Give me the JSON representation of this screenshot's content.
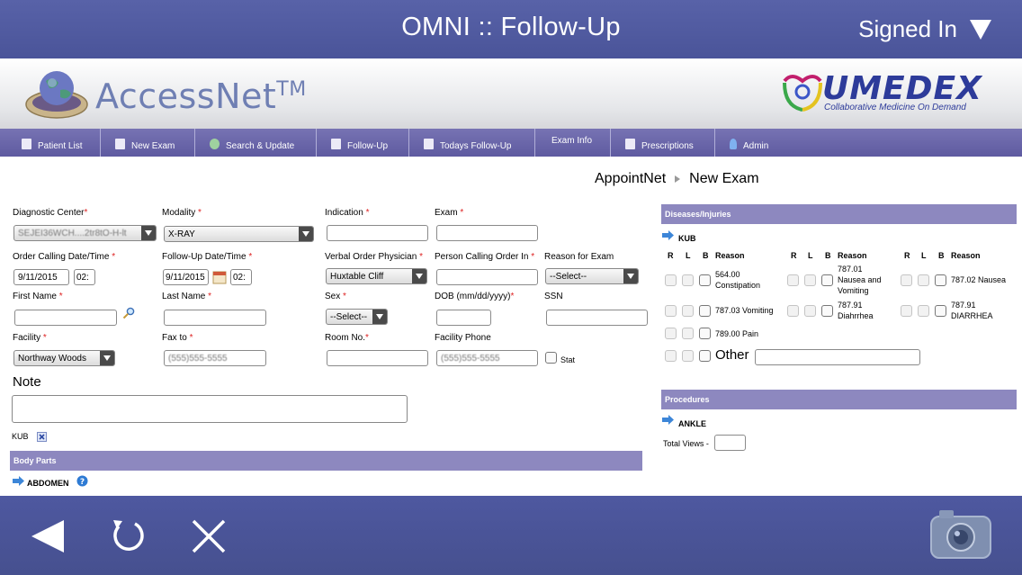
{
  "topbar": {
    "title": "OMNI :: Follow-Up",
    "signed_in": "Signed In"
  },
  "brand": {
    "accessnet": "AccessNet",
    "tm": "TM",
    "umedex": "UMEDEX",
    "umedex_tag": "Collaborative Medicine On Demand"
  },
  "nav": [
    {
      "label": "Patient List",
      "icon": "patient-list-icon"
    },
    {
      "label": "New Exam",
      "icon": "document-icon"
    },
    {
      "label": "Search & Update",
      "icon": "gear-icon"
    },
    {
      "label": "Follow-Up",
      "icon": "calendar-icon"
    },
    {
      "label": "Todays Follow-Up",
      "icon": "calendar-icon"
    },
    {
      "label": "Exam Info",
      "icon": ""
    },
    {
      "label": "Prescriptions",
      "icon": "clipboard-icon"
    },
    {
      "label": "Admin",
      "icon": "user-icon"
    }
  ],
  "breadcrumb": {
    "parent": "AppointNet",
    "current": "New Exam"
  },
  "form": {
    "diagnostic_center": {
      "label": "Diagnostic Center",
      "value": "SEJEI36WCH....2tr8tO-H-lt"
    },
    "modality": {
      "label": "Modality",
      "value": "X-RAY"
    },
    "indication": {
      "label": "Indication"
    },
    "exam": {
      "label": "Exam"
    },
    "order_calling": {
      "label": "Order Calling Date/Time",
      "date": "9/11/2015",
      "time": "02:"
    },
    "followup_dt": {
      "label": "Follow-Up Date/Time",
      "date": "9/11/2015",
      "time": "02:"
    },
    "verbal_physician": {
      "label": "Verbal Order Physician",
      "value": "Huxtable Cliff"
    },
    "person_calling": {
      "label": "Person Calling Order In"
    },
    "reason_exam": {
      "label": "Reason for Exam",
      "value": "--Select--"
    },
    "first_name": {
      "label": "First Name"
    },
    "last_name": {
      "label": "Last Name"
    },
    "sex": {
      "label": "Sex",
      "value": "--Select--"
    },
    "dob": {
      "label": "DOB (mm/dd/yyyy)"
    },
    "ssn": {
      "label": "SSN"
    },
    "facility": {
      "label": "Facility",
      "value": "Northway Woods"
    },
    "fax_to": {
      "label": "Fax to",
      "value": "(555)555-5555"
    },
    "room_no": {
      "label": "Room No."
    },
    "facility_phone": {
      "label": "Facility Phone",
      "value": "(555)555-5555"
    },
    "stat": {
      "label": "Stat"
    },
    "required_mark": "*"
  },
  "note": {
    "label": "Note"
  },
  "kub_tag": "KUB",
  "body_parts": {
    "header": "Body Parts",
    "item": "ABDOMEN"
  },
  "diseases": {
    "header": "Diseases/Injuries",
    "group": "KUB",
    "columns": {
      "r": "R",
      "l": "L",
      "b": "B",
      "reason": "Reason"
    },
    "items": [
      [
        "564.00",
        "Constipation"
      ],
      [
        "787.01",
        "Nausea and",
        "Vomiting"
      ],
      [
        "787.02 Nausea"
      ],
      [
        "787.03 Vomiting"
      ],
      [
        "787.91",
        "Diahrrhea"
      ],
      [
        "787.91",
        "DIARRHEA"
      ],
      [
        "789.00 Pain"
      ]
    ],
    "other": "Other"
  },
  "procedures": {
    "header": "Procedures",
    "item": "ANKLE",
    "total_views": "Total Views -"
  },
  "colors": {
    "bar": "#4a5499",
    "nav": "#6a66a8",
    "section": "#8d88bf",
    "link_blue": "#2e7bd4"
  }
}
